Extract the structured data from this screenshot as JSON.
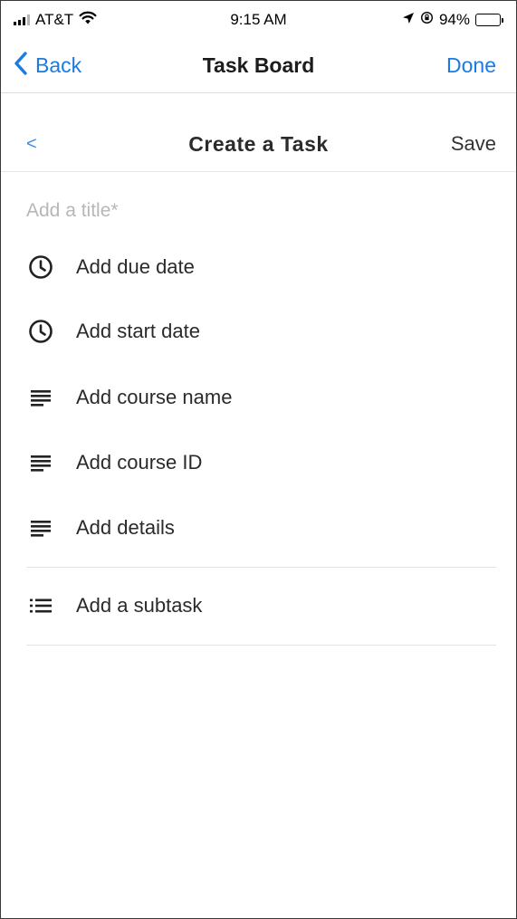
{
  "status_bar": {
    "carrier": "AT&T",
    "time": "9:15 AM",
    "battery": "94%",
    "icons": [
      "signal-icon",
      "wifi-icon",
      "location-arrow-icon",
      "orientation-lock-icon",
      "battery-icon"
    ]
  },
  "nav": {
    "back_label": "Back",
    "title": "Task Board",
    "done_label": "Done",
    "accent_color": "#1a7be0"
  },
  "form": {
    "back_glyph": "<",
    "title": "Create a Task",
    "save_label": "Save",
    "title_placeholder": "Add a title*"
  },
  "fields": [
    {
      "label": "Add due date",
      "icon": "clock-icon"
    },
    {
      "label": "Add start date",
      "icon": "clock-icon"
    },
    {
      "label": "Add course name",
      "icon": "text-lines-icon"
    },
    {
      "label": "Add course ID",
      "icon": "text-lines-icon"
    },
    {
      "label": "Add details",
      "icon": "text-lines-icon"
    }
  ],
  "subtask": {
    "label": "Add a subtask",
    "icon": "list-icon"
  }
}
